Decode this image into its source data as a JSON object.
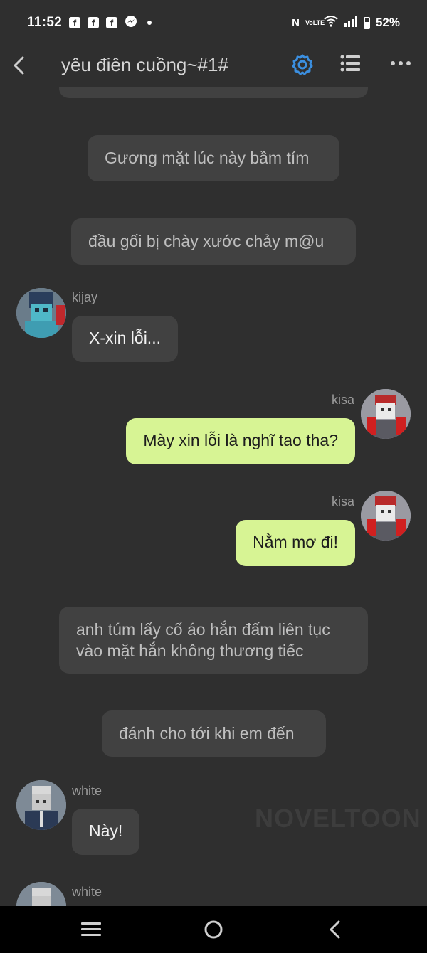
{
  "status_bar": {
    "time": "11:52",
    "notifications": [
      "facebook-icon",
      "facebook-icon",
      "facebook-icon",
      "messenger-icon"
    ],
    "network": "VoLTE",
    "battery": "52%"
  },
  "header": {
    "title": "yêu điên cuồng~#1#",
    "accent_color": "#3b8fe0"
  },
  "messages": {
    "narration_1": "Gương mặt lúc này bầm tím",
    "narration_2": "đầu gối bị chày xước chảy m@u",
    "kijay_name": "kijay",
    "kijay_text": "X-xin lỗi...",
    "kisa1_name": "kisa",
    "kisa1_text": "Mày xin lỗi là nghĩ tao tha?",
    "kisa2_name": "kisa",
    "kisa2_text": "Nằm mơ đi!",
    "narration_3": "anh túm lấy cổ áo hắn đấm liên tục vào mặt hắn không thương tiếc",
    "narration_4": "đánh cho tới khi em đến",
    "white1_name": "white",
    "white1_text": "Này!",
    "white2_name": "white"
  },
  "colors": {
    "background": "#2f2f2f",
    "bubble_other": "#414141",
    "bubble_self": "#d7f494"
  },
  "watermark": "NOVELTOON"
}
